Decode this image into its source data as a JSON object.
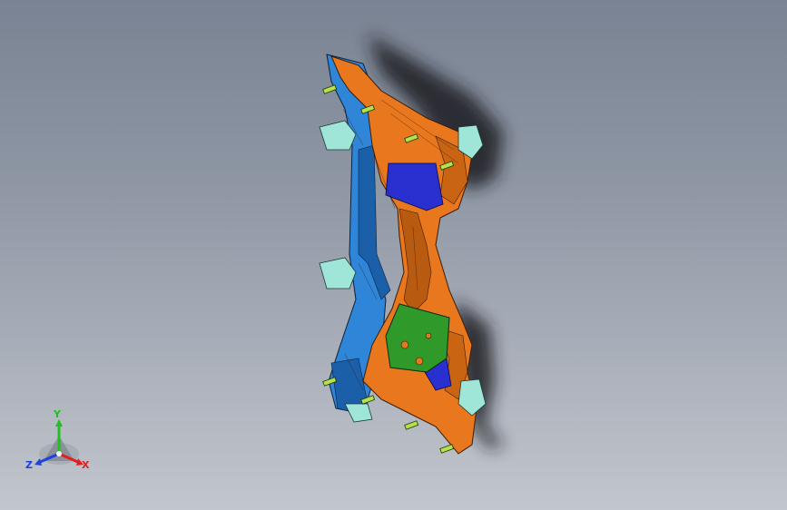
{
  "viewport": {
    "background_top": "#7a8393",
    "background_bottom": "#c2c6cd"
  },
  "model": {
    "description_icon": "cad-subframe-assembly",
    "colors": {
      "frame_orange": "#e8771e",
      "frame_orange_dark": "#b85a10",
      "rail_blue": "#2f86d8",
      "rail_blue_dark": "#1b5fa8",
      "bracket_navy": "#2a2fd0",
      "plate_green": "#2f9a2a",
      "mount_cyan": "#9fe6d8",
      "shadow": "#1d1f24",
      "bolt_green": "#b8e04a"
    }
  },
  "triad": {
    "y_label": "Y",
    "x_label": "X",
    "z_label": "Z",
    "colors": {
      "x": "#e02020",
      "y": "#20c020",
      "z": "#2040e0"
    }
  }
}
